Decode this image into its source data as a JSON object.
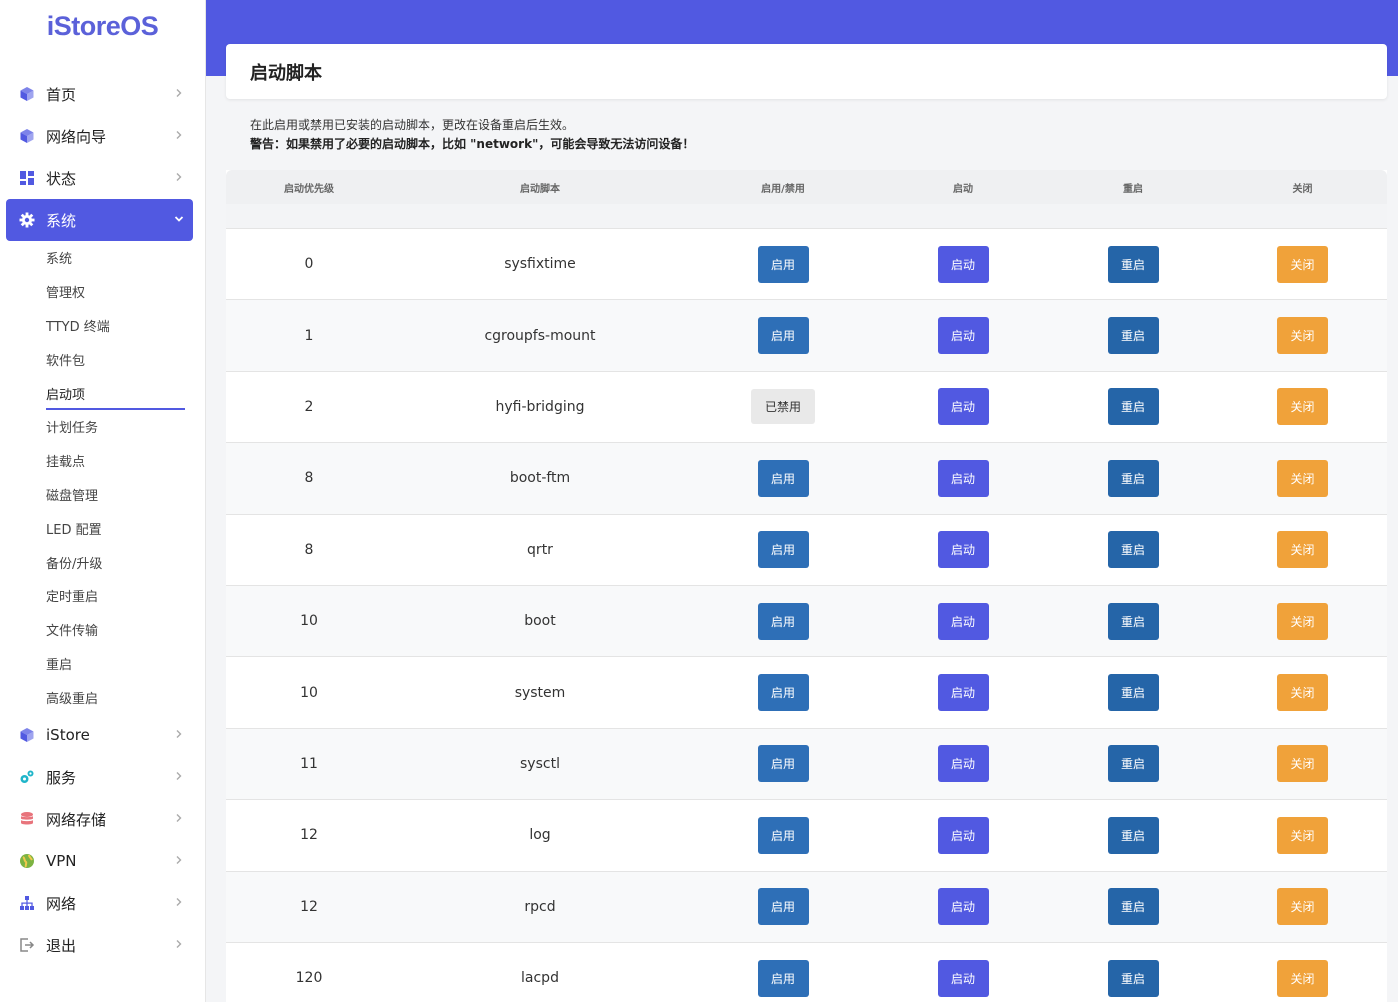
{
  "app": {
    "logo": "iStoreOS"
  },
  "sidebar": {
    "items": [
      {
        "label": "首页",
        "icon": "cube-icon",
        "color": "#5159e1"
      },
      {
        "label": "网络向导",
        "icon": "cube-icon",
        "color": "#5159e1"
      },
      {
        "label": "状态",
        "icon": "dashboard-icon",
        "color": "#5159e1"
      },
      {
        "label": "系统",
        "icon": "gear-icon",
        "color": "#ffffff",
        "active": true
      },
      {
        "label": "iStore",
        "icon": "cube-icon",
        "color": "#5159e1"
      },
      {
        "label": "服务",
        "icon": "cogs-icon",
        "color": "#1fb5c9"
      },
      {
        "label": "网络存储",
        "icon": "database-icon",
        "color": "#e8747c"
      },
      {
        "label": "VPN",
        "icon": "globe-icon",
        "color": "#7cb342"
      },
      {
        "label": "网络",
        "icon": "sitemap-icon",
        "color": "#5159e1"
      },
      {
        "label": "退出",
        "icon": "logout-icon",
        "color": "#888888"
      }
    ],
    "subitems": [
      "系统",
      "管理权",
      "TTYD 终端",
      "软件包",
      "启动项",
      "计划任务",
      "挂载点",
      "磁盘管理",
      "LED 配置",
      "备份/升级",
      "定时重启",
      "文件传输",
      "重启",
      "高级重启"
    ],
    "active_sub": "启动项"
  },
  "page": {
    "title": "启动脚本",
    "desc_line1": "在此启用或禁用已安装的启动脚本，更改在设备重启后生效。",
    "desc_line2": "警告：如果禁用了必要的启动脚本，比如 \"network\"，可能会导致无法访问设备！"
  },
  "table": {
    "headers": [
      "启动优先级",
      "启动脚本",
      "启用/禁用",
      "启动",
      "重启",
      "关闭"
    ],
    "buttons": {
      "enable": "启用",
      "disabled": "已禁用",
      "start": "启动",
      "restart": "重启",
      "stop": "关闭"
    },
    "rows": [
      {
        "priority": "0",
        "script": "sysfixtime",
        "enabled": true
      },
      {
        "priority": "1",
        "script": "cgroupfs-mount",
        "enabled": true
      },
      {
        "priority": "2",
        "script": "hyfi-bridging",
        "enabled": false
      },
      {
        "priority": "8",
        "script": "boot-ftm",
        "enabled": true
      },
      {
        "priority": "8",
        "script": "qrtr",
        "enabled": true
      },
      {
        "priority": "10",
        "script": "boot",
        "enabled": true
      },
      {
        "priority": "10",
        "script": "system",
        "enabled": true
      },
      {
        "priority": "11",
        "script": "sysctl",
        "enabled": true
      },
      {
        "priority": "12",
        "script": "log",
        "enabled": true
      },
      {
        "priority": "12",
        "script": "rpcd",
        "enabled": true
      },
      {
        "priority": "120",
        "script": "lacpd",
        "enabled": true
      }
    ]
  },
  "colors": {
    "accent": "#5159e1",
    "enable_btn": "#2e6fb7",
    "restart_btn": "#2565a8",
    "stop_btn": "#f0a23a"
  }
}
